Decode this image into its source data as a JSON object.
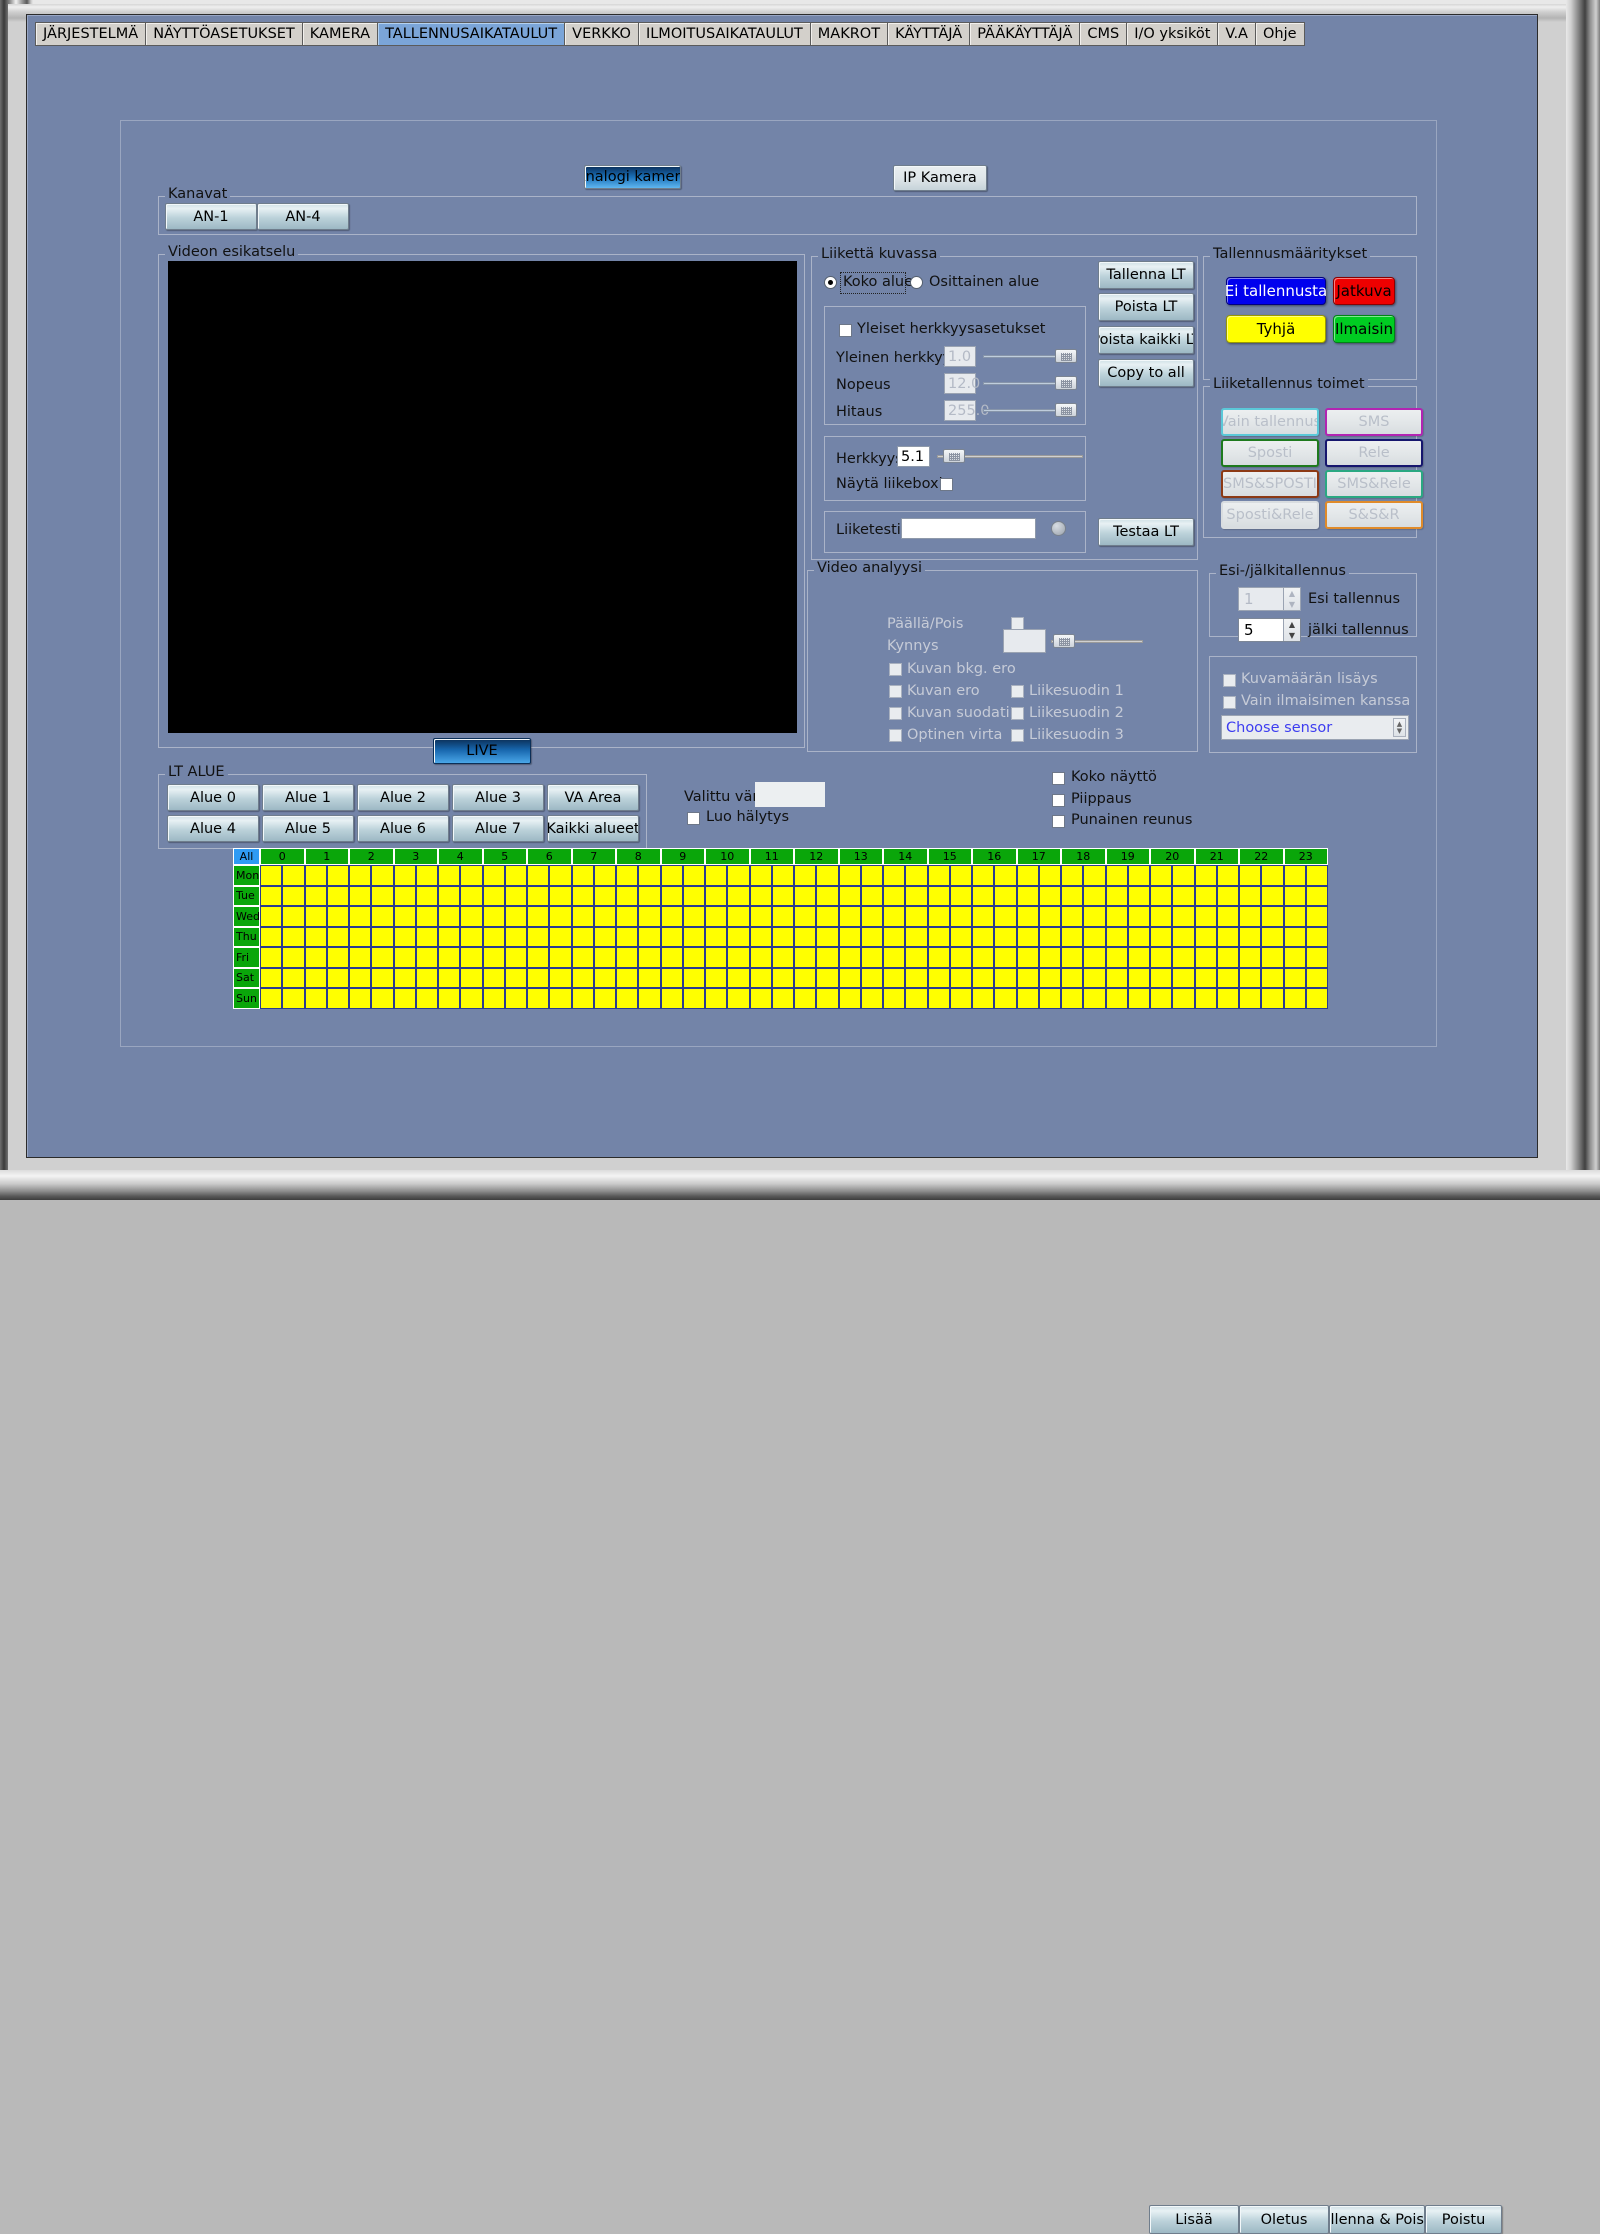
{
  "window": {
    "title": "TALLENNUSAIKATAULUT"
  },
  "tabs": [
    {
      "label": "JÄRJESTELMÄ",
      "active": false
    },
    {
      "label": "NÄYTTÖASETUKSET",
      "active": false
    },
    {
      "label": "KAMERA",
      "active": false
    },
    {
      "label": "TALLENNUSAIKATAULUT",
      "active": true
    },
    {
      "label": "VERKKO",
      "active": false
    },
    {
      "label": "ILMOITUSAIKATAULUT",
      "active": false
    },
    {
      "label": "MAKROT",
      "active": false
    },
    {
      "label": "KÄYTTÄJÄ",
      "active": false
    },
    {
      "label": "PÄÄKÄYTTÄJÄ",
      "active": false
    },
    {
      "label": "CMS",
      "active": false
    },
    {
      "label": "I/O yksiköt",
      "active": false
    },
    {
      "label": "V.A",
      "active": false
    },
    {
      "label": "Ohje",
      "active": false
    }
  ],
  "camera_type": {
    "analog_label": "Analogi kamera",
    "ip_label": "IP Kamera",
    "selected": "Analogi kamera"
  },
  "channels": {
    "title": "Kanavat",
    "items": [
      "AN-1",
      "AN-4"
    ]
  },
  "preview": {
    "title": "Videon esikatselu",
    "live_label": "LIVE"
  },
  "motion": {
    "title": "Liikettä kuvassa",
    "radio_full": "Koko alue",
    "radio_partial": "Osittainen alue",
    "radio_selected": "Koko alue",
    "general_settings_label": "Yleiset herkkyysasetukset",
    "general_settings_checked": false,
    "rows": [
      {
        "label": "Yleinen herkkyys",
        "value": "1.0",
        "slider_pct": 92,
        "disabled": true
      },
      {
        "label": "Nopeus",
        "value": "12.0",
        "slider_pct": 92,
        "disabled": true
      },
      {
        "label": "Hitaus",
        "value": "255.0",
        "slider_pct": 92,
        "disabled": true
      }
    ],
    "sensitivity_label": "Herkkyys",
    "sensitivity_value": "5.1",
    "sensitivity_slider_pct": 5,
    "show_boxes_label": "Näytä liikeboxit",
    "show_boxes_checked": false,
    "motion_test_label": "Liiketesti",
    "motion_test_value": "",
    "buttons": {
      "save_lt": "Tallenna LT",
      "delete_lt": "Poista LT",
      "delete_all_lt": "Poista kaikki LT",
      "copy_to_all": "Copy to all",
      "test_lt": "Testaa LT"
    }
  },
  "video_analysis": {
    "title": "Video analyysi",
    "onoff_label": "Päällä/Pois",
    "onoff_checked": false,
    "threshold_label": "Kynnys",
    "threshold_value": "",
    "threshold_slider_pct": 4,
    "checks_left": [
      {
        "label": "Kuvan bkg. ero",
        "checked": false
      },
      {
        "label": "Kuvan ero",
        "checked": false
      },
      {
        "label": "Kuvan suodatin",
        "checked": false
      },
      {
        "label": "Optinen virta",
        "checked": false
      }
    ],
    "checks_right": [
      {
        "label": "Liikesuodin 1",
        "checked": false
      },
      {
        "label": "Liikesuodin 2",
        "checked": false
      },
      {
        "label": "Liikesuodin 3",
        "checked": false
      }
    ]
  },
  "record_modes": {
    "title": "Tallennusmääritykset",
    "items": [
      {
        "label": "Ei tallennusta",
        "bg": "#0000ee",
        "fg": "#ffffff"
      },
      {
        "label": "Jatkuva",
        "bg": "#ee0000",
        "fg": "#000000"
      },
      {
        "label": "Tyhjä",
        "bg": "#ffff00",
        "fg": "#000000"
      },
      {
        "label": "Ilmaisin",
        "bg": "#00cc22",
        "fg": "#000000"
      }
    ]
  },
  "motion_actions": {
    "title": "Liiketallennus toimet",
    "items": [
      {
        "label": "Vain tallennus",
        "border": "#5bc8d8"
      },
      {
        "label": "SMS",
        "border": "#b224b2"
      },
      {
        "label": "Sposti",
        "border": "#1e7a1e"
      },
      {
        "label": "Rele",
        "border": "#16166e"
      },
      {
        "label": "SMS&SPOSTI",
        "border": "#8c3a15"
      },
      {
        "label": "SMS&Rele",
        "border": "#2aa882"
      },
      {
        "label": "Sposti&Rele",
        "border": "#d9dde0"
      },
      {
        "label": "S&S&R",
        "border": "#e08b2a"
      }
    ]
  },
  "prepost": {
    "title": "Esi-/jälkitallennus",
    "pre_value": "1",
    "pre_label": "Esi tallennus",
    "post_value": "5",
    "post_label": "jälki tallennus"
  },
  "sensor_box": {
    "add_frames_label": "Kuvamäärän lisäys",
    "add_frames_checked": false,
    "only_with_detector_label": "Vain ilmaisimen kanssa",
    "only_with_detector_checked": false,
    "sensor_select_value": "Choose sensor"
  },
  "lt_area": {
    "title": "LT ALUE",
    "row1": [
      "Alue 0",
      "Alue 1",
      "Alue 2",
      "Alue 3",
      "VA Area"
    ],
    "row2": [
      "Alue 4",
      "Alue 5",
      "Alue 6",
      "Alue 7",
      "Kaikki alueet"
    ]
  },
  "misc": {
    "selected_color_label": "Valittu väri",
    "selected_color_value": "#eceff1",
    "create_alarm_label": "Luo hälytys",
    "create_alarm_checked": false,
    "fullscreen_label": "Koko näyttö",
    "fullscreen_checked": false,
    "beep_label": "Piippaus",
    "beep_checked": false,
    "red_border_label": "Punainen reunus",
    "red_border_checked": false
  },
  "schedule": {
    "all_label": "All",
    "hours": [
      "0",
      "1",
      "2",
      "3",
      "4",
      "5",
      "6",
      "7",
      "8",
      "9",
      "10",
      "11",
      "12",
      "13",
      "14",
      "15",
      "16",
      "17",
      "18",
      "19",
      "20",
      "21",
      "22",
      "23"
    ],
    "days": [
      "Mon",
      "Tue",
      "Wed",
      "Thu",
      "Fri",
      "Sat",
      "Sun"
    ],
    "cell_color": "#ffff00",
    "subcolumns_per_hour": 2
  },
  "footer": {
    "buttons": [
      "Lisää",
      "Oletus",
      "Tallenna & Poistu",
      "Poistu"
    ]
  }
}
